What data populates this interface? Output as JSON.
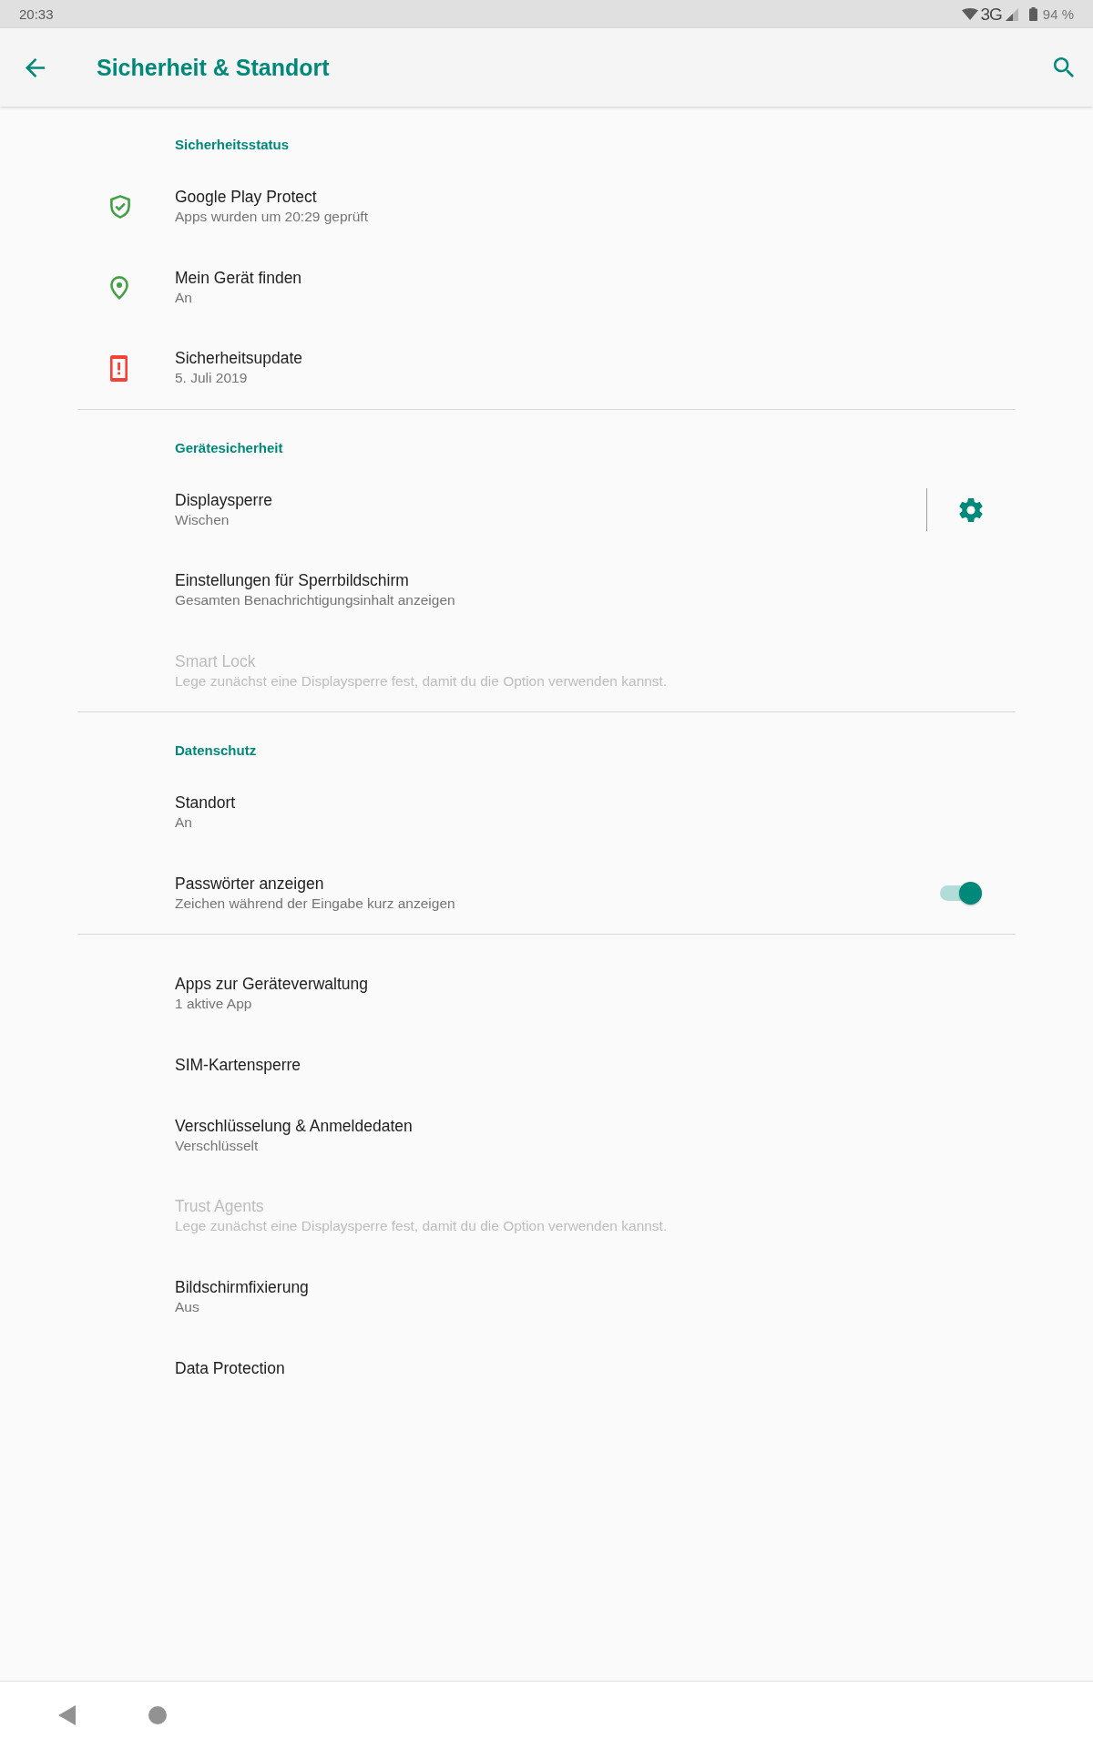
{
  "status_bar": {
    "time": "20:33",
    "network": "3G",
    "battery": "94 %"
  },
  "app_bar": {
    "title": "Sicherheit & Standort"
  },
  "sections": [
    {
      "header": "Sicherheitsstatus",
      "items": [
        {
          "kind": "status",
          "title": "Google Play Protect",
          "summary": "Apps wurden um 20:29 geprüft",
          "color": "#43a047",
          "disabled": false
        },
        {
          "kind": "status",
          "title": "Mein Gerät finden",
          "summary": "An",
          "color": "#43a047",
          "disabled": false
        },
        {
          "kind": "status",
          "title": "Sicherheitsupdate",
          "summary": "5. Juli 2019",
          "color": "#f44336",
          "disabled": false
        }
      ]
    },
    {
      "header": "Gerätesicherheit",
      "items": [
        {
          "kind": "gear",
          "title": "Displaysperre",
          "summary": "Wischen",
          "disabled": false
        },
        {
          "kind": "plain",
          "title": "Einstellungen für Sperrbildschirm",
          "summary": "Gesamten Benachrichtigungsinhalt anzeigen",
          "disabled": false
        },
        {
          "kind": "plain",
          "title": "Smart Lock",
          "summary": "Lege zunächst eine Displaysperre fest, damit du die Option verwenden kannst.",
          "disabled": true
        }
      ]
    },
    {
      "header": "Datenschutz",
      "items": [
        {
          "kind": "plain",
          "title": "Standort",
          "summary": "An",
          "disabled": false
        },
        {
          "kind": "switch",
          "title": "Passwörter anzeigen",
          "summary": "Zeichen während der Eingabe kurz anzeigen",
          "on": true,
          "disabled": false
        }
      ]
    },
    {
      "items": [
        {
          "kind": "plain",
          "title": "Apps zur Geräteverwaltung",
          "summary": "1 aktive App",
          "disabled": false
        },
        {
          "kind": "plain",
          "title": "SIM-Kartensperre",
          "disabled": false
        },
        {
          "kind": "plain",
          "title": "Verschlüsselung & Anmeldedaten",
          "summary": "Verschlüsselt",
          "disabled": false
        },
        {
          "kind": "plain",
          "title": "Trust Agents",
          "summary": "Lege zunächst eine Displaysperre fest, damit du die Option verwenden kannst.",
          "disabled": true
        },
        {
          "kind": "plain",
          "title": "Bildschirmfixierung",
          "summary": "Aus",
          "disabled": false
        },
        {
          "kind": "plain",
          "title": "Data Protection",
          "disabled": false
        }
      ]
    }
  ]
}
